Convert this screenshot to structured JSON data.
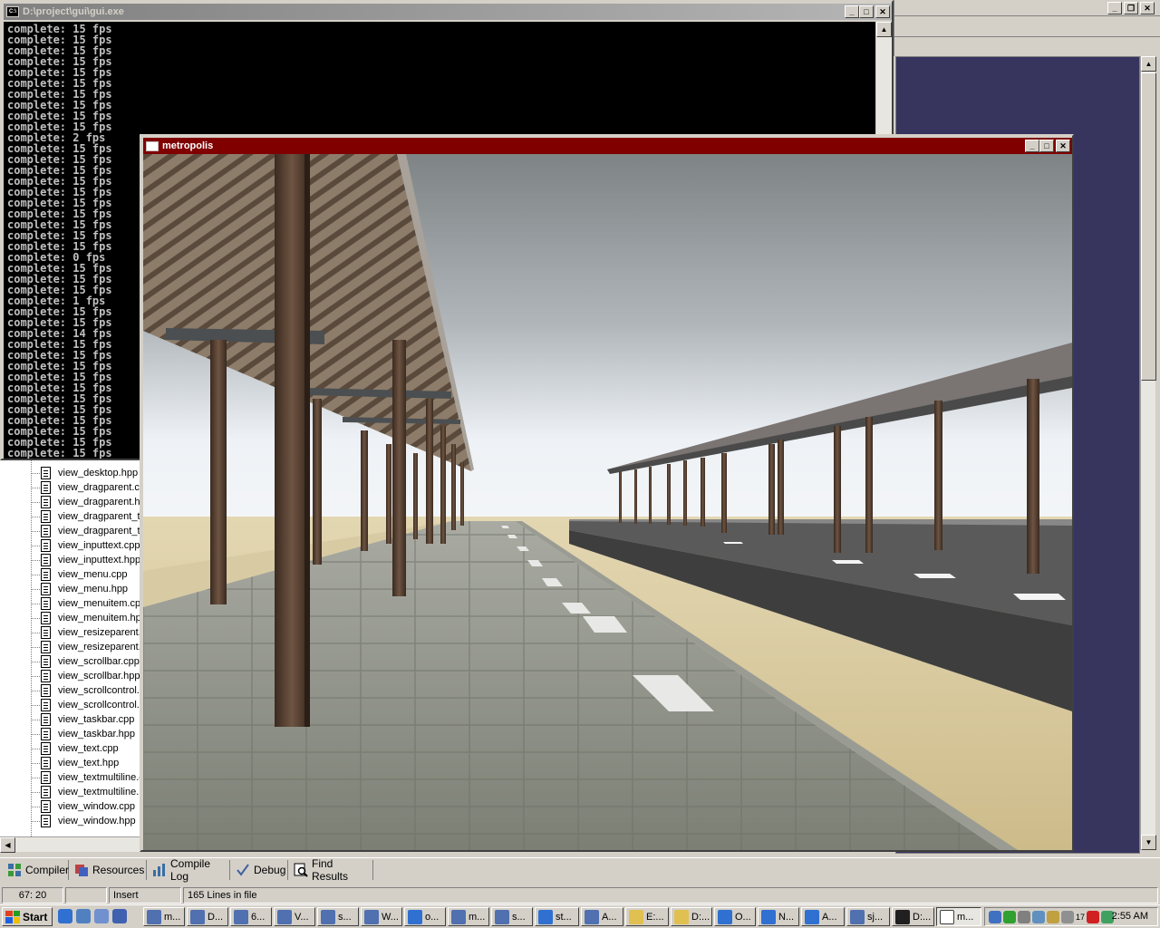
{
  "console": {
    "title": "D:\\project\\gui\\gui.exe",
    "lines": [
      "complete: 15 fps",
      "complete: 15 fps",
      "complete: 15 fps",
      "complete: 15 fps",
      "complete: 15 fps",
      "complete: 15 fps",
      "complete: 15 fps",
      "complete: 15 fps",
      "complete: 15 fps",
      "complete: 15 fps",
      "complete: 2 fps",
      "complete: 15 fps",
      "complete: 15 fps",
      "complete: 15 fps",
      "complete: 15 fps",
      "complete: 15 fps",
      "complete: 15 fps",
      "complete: 15 fps",
      "complete: 15 fps",
      "complete: 15 fps",
      "complete: 15 fps",
      "complete: 0 fps",
      "complete: 15 fps",
      "complete: 15 fps",
      "complete: 15 fps",
      "complete: 1 fps",
      "complete: 15 fps",
      "complete: 15 fps",
      "complete: 14 fps",
      "complete: 15 fps",
      "complete: 15 fps",
      "complete: 15 fps",
      "complete: 15 fps",
      "complete: 15 fps",
      "complete: 15 fps",
      "complete: 15 fps",
      "complete: 15 fps",
      "complete: 15 fps",
      "complete: 15 fps",
      "complete: 15 fps",
      "complete: 15 fps"
    ]
  },
  "metropolis": {
    "title": "metropolis"
  },
  "file_tree": {
    "items": [
      "view_desktop.hpp",
      "view_dragparent.c",
      "view_dragparent.h",
      "view_dragparent_t",
      "view_dragparent_t",
      "view_inputtext.cpp",
      "view_inputtext.hpp",
      "view_menu.cpp",
      "view_menu.hpp",
      "view_menuitem.cp",
      "view_menuitem.hp",
      "view_resizeparent.",
      "view_resizeparent.",
      "view_scrollbar.cpp",
      "view_scrollbar.hpp",
      "view_scrollcontrol.",
      "view_scrollcontrol.",
      "view_taskbar.cpp",
      "view_taskbar.hpp",
      "view_text.cpp",
      "view_text.hpp",
      "view_textmultiline.c",
      "view_textmultiline.h",
      "view_window.cpp",
      "view_window.hpp"
    ]
  },
  "bottom_tabs": [
    {
      "label": "Compiler",
      "icon": "compiler-icon"
    },
    {
      "label": "Resources",
      "icon": "resources-icon"
    },
    {
      "label": "Compile Log",
      "icon": "compile-log-icon"
    },
    {
      "label": "Debug",
      "icon": "debug-check-icon"
    },
    {
      "label": "Find Results",
      "icon": "find-results-icon"
    }
  ],
  "status_bar": {
    "position": "67: 20",
    "mode": "Insert",
    "lines": "165 Lines in file"
  },
  "taskbar": {
    "start_label": "Start",
    "tasks": [
      {
        "label": "m...",
        "icon": "app-icon"
      },
      {
        "label": "D...",
        "icon": "app-icon"
      },
      {
        "label": "6...",
        "icon": "app-icon"
      },
      {
        "label": "V...",
        "icon": "app-icon"
      },
      {
        "label": "s...",
        "icon": "app-icon"
      },
      {
        "label": "W...",
        "icon": "app-icon"
      },
      {
        "label": "o...",
        "icon": "ie-icon"
      },
      {
        "label": "m...",
        "icon": "app-icon"
      },
      {
        "label": "s...",
        "icon": "app-icon"
      },
      {
        "label": "st...",
        "icon": "ie-icon"
      },
      {
        "label": "A...",
        "icon": "app-icon"
      },
      {
        "label": "E:...",
        "icon": "folder-icon"
      },
      {
        "label": "D:...",
        "icon": "folder-icon"
      },
      {
        "label": "O...",
        "icon": "ie-icon"
      },
      {
        "label": "N...",
        "icon": "ie-icon"
      },
      {
        "label": "A...",
        "icon": "ie-icon"
      },
      {
        "label": "sj...",
        "icon": "app-icon"
      },
      {
        "label": "D:...",
        "icon": "console-icon"
      },
      {
        "label": "m...",
        "icon": "window-icon"
      }
    ],
    "tray_text": "17",
    "clock": "2:55 AM"
  },
  "colors": {
    "metro_title": "#800000",
    "editor_bg": "#37355e",
    "console_bg": "#000000",
    "console_text": "#c0c0c0"
  }
}
